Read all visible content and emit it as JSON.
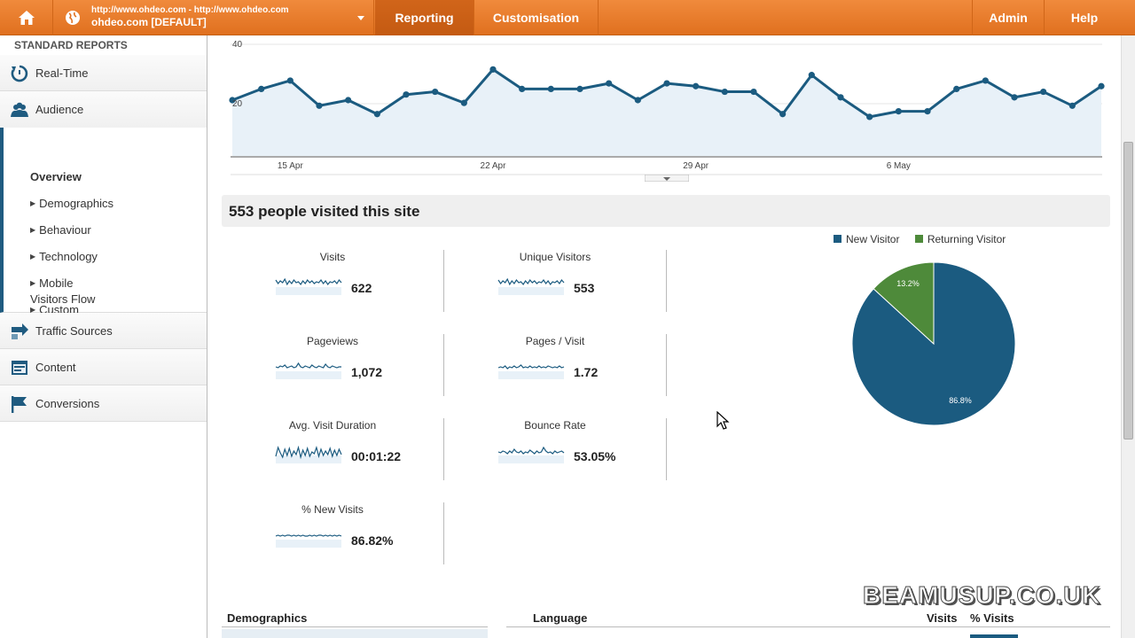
{
  "topbar": {
    "account_urls": "http://www.ohdeo.com - http://www.ohdeo.com",
    "account_name": "ohdeo.com [DEFAULT]",
    "nav": {
      "reporting": "Reporting",
      "customisation": "Customisation",
      "admin": "Admin",
      "help": "Help"
    }
  },
  "sidebar": {
    "header": "STANDARD REPORTS",
    "realtime": "Real-Time",
    "audience": "Audience",
    "audience_items": {
      "overview": "Overview",
      "demographics": "Demographics",
      "behaviour": "Behaviour",
      "technology": "Technology",
      "mobile": "Mobile",
      "custom": "Custom",
      "visitors_flow": "Visitors Flow"
    },
    "traffic_sources": "Traffic Sources",
    "content": "Content",
    "conversions": "Conversions"
  },
  "chart_data": {
    "type": "area",
    "y_ticks": [
      "40",
      "20"
    ],
    "ylim": [
      0,
      40
    ],
    "x_tick_labels": [
      "15 Apr",
      "22 Apr",
      "29 Apr",
      "6 May"
    ],
    "values": [
      20,
      24,
      27,
      18,
      20,
      15,
      22,
      23,
      19,
      31,
      24,
      24,
      24,
      26,
      20,
      26,
      25,
      23,
      23,
      15,
      29,
      21,
      14,
      16,
      16,
      24,
      27,
      21,
      23,
      18,
      25
    ]
  },
  "summary": {
    "title": "553 people visited this site"
  },
  "metrics": {
    "visits": {
      "label": "Visits",
      "value": "622"
    },
    "unique": {
      "label": "Unique Visitors",
      "value": "553"
    },
    "pageviews": {
      "label": "Pageviews",
      "value": "1,072"
    },
    "pages_visit": {
      "label": "Pages / Visit",
      "value": "1.72"
    },
    "duration": {
      "label": "Avg. Visit Duration",
      "value": "00:01:22"
    },
    "bounce": {
      "label": "Bounce Rate",
      "value": "53.05%"
    },
    "new_visits": {
      "label": "% New Visits",
      "value": "86.82%"
    }
  },
  "pie": {
    "new_label": "New Visitor",
    "returning_label": "Returning Visitor",
    "new_pct_label": "86.8%",
    "returning_pct_label": "13.2%",
    "new_fraction": 0.868,
    "new_color": "#1b5b80",
    "returning_color": "#4e8a3a"
  },
  "watermark": "BEAMUSUP.CO.UK",
  "bottom": {
    "demographics": "Demographics",
    "language": "Language",
    "visits_col": "Visits",
    "pct_visits_col": "% Visits"
  }
}
